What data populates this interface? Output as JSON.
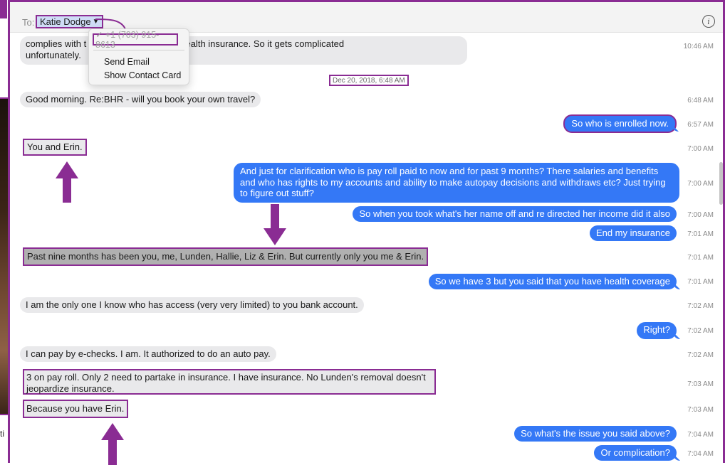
{
  "header": {
    "to_label": "To:",
    "recipient": "Katie Dodge",
    "info_icon": "info-circle-icon"
  },
  "dropdown": {
    "phone": "✓ +1 (703) 915-8613",
    "send_email": "Send Email",
    "show_contact_card": "Show Contact Card"
  },
  "left_strip": {
    "stray_text": "ti"
  },
  "date_separator": "Dec 20, 2018, 6:48 AM",
  "messages": [
    {
      "dir": "in",
      "line1": "complies with t",
      "line1b": "ployees enrolled in health insurance.  So it gets complicated",
      "line2": "unfortunately.",
      "time": "10:46 AM"
    },
    {
      "dir": "in",
      "text": "Good morning. Re:BHR - will you book your own travel?",
      "time": "6:48 AM"
    },
    {
      "dir": "out",
      "text": "So who is enrolled now.",
      "time": "6:57 AM"
    },
    {
      "dir": "in",
      "text": "You and Erin.",
      "time": "7:00 AM"
    },
    {
      "dir": "out",
      "line1": "And just for clarification who is pay roll paid to now and for past 9 months? There salaries and benefits",
      "line2": "and who has rights to my accounts and ability to make autopay decisions and withdraws etc? Just trying",
      "line3": "to figure out stuff?",
      "time": "7:00 AM"
    },
    {
      "dir": "out",
      "text": "So when you took what's her name off and re directed her income did it also",
      "time": "7:00 AM"
    },
    {
      "dir": "out",
      "text": "End my insurance",
      "time": "7:01 AM"
    },
    {
      "dir": "in",
      "text": "Past nine months has been you, me, Lunden, Hallie, Liz & Erin. But currently only you me & Erin.",
      "time": "7:01 AM"
    },
    {
      "dir": "out",
      "text": "So we have 3 but you said that you have health coverage",
      "time": "7:01 AM"
    },
    {
      "dir": "in",
      "text": "I am the only one I know who has access (very very limited) to you bank account.",
      "time": "7:02 AM"
    },
    {
      "dir": "out",
      "text": "Right?",
      "time": "7:02 AM"
    },
    {
      "dir": "in",
      "text": "I can pay by e-checks. I am. It authorized to do an auto pay.",
      "time": "7:02 AM"
    },
    {
      "dir": "in",
      "line1": "3 on pay roll. Only 2 need to partake in insurance. I have insurance. No Lunden's removal doesn't",
      "line2": "jeopardize insurance.",
      "time": "7:03 AM"
    },
    {
      "dir": "in",
      "text": "Because you have Erin.",
      "time": "7:03 AM"
    },
    {
      "dir": "out",
      "text": "So what's the issue you said above?",
      "time": "7:04 AM"
    },
    {
      "dir": "out",
      "text": "Or complication?",
      "time": "7:04 AM"
    }
  ],
  "colors": {
    "annotation_purple": "#8a2c93",
    "outgoing_bubble": "#3478f6",
    "incoming_bubble": "#e9e9eb"
  }
}
